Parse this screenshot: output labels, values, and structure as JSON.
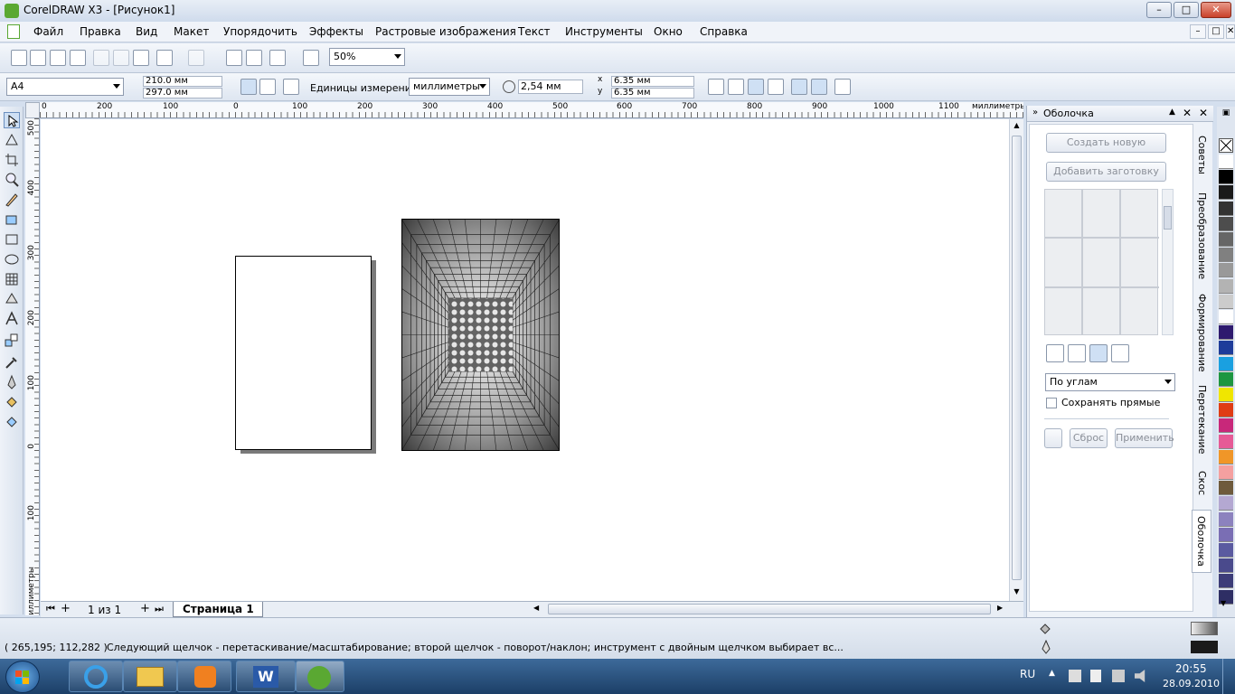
{
  "window": {
    "title": "CorelDRAW X3 - [Рисунок1]",
    "controls": {
      "minimize": "–",
      "maximize": "□",
      "close": "✕"
    }
  },
  "menu": {
    "items": [
      "Файл",
      "Правка",
      "Вид",
      "Макет",
      "Упорядочить",
      "Эффекты",
      "Растровые изображения",
      "Текст",
      "Инструменты",
      "Окно",
      "Справка"
    ]
  },
  "toolbar": {
    "zoom": "50%"
  },
  "property_bar": {
    "page_size": "A4",
    "width": "210.0 мм",
    "height": "297.0 мм",
    "units_label": "Единицы измерения:",
    "units_value": "миллиметры",
    "nudge": "2,54 мм",
    "dup_x": "6.35 мм",
    "dup_y": "6.35 мм",
    "x_label": "x",
    "y_label": "y"
  },
  "rulers": {
    "unit": "миллиметры",
    "h_ticks": [
      "0",
      "200",
      "100",
      "0",
      "100",
      "200",
      "300",
      "400",
      "500",
      "600",
      "700",
      "800",
      "900",
      "1000",
      "1100"
    ],
    "v_ticks": [
      "500",
      "400",
      "300",
      "200",
      "100",
      "0",
      "100"
    ],
    "v_unit": "миллиметры"
  },
  "page_nav": {
    "counter": "1 из 1",
    "tab": "Страница 1"
  },
  "docker": {
    "title": "Оболочка",
    "create_new": "Создать новую",
    "add_preset": "Добавить заготовку",
    "mapping_mode": "По углам",
    "keep_lines": "Сохранять прямые",
    "reset": "Сброс",
    "apply": "Применить"
  },
  "side_tabs": [
    "Советы",
    "Преобразование",
    "Формирование",
    "Перетекание",
    "Скос",
    "Оболочка"
  ],
  "palette": {
    "colors": [
      "#ffffff",
      "#000000",
      "#1a1a1a",
      "#333333",
      "#4d4d4d",
      "#666666",
      "#808080",
      "#999999",
      "#b3b3b3",
      "#cccccc",
      "#ffffff",
      "#2e1a6e",
      "#1e3c9a",
      "#1aa0e0",
      "#1e9640",
      "#f0e600",
      "#e03c14",
      "#c8287a",
      "#e65a96",
      "#f09628",
      "#f5a0a0",
      "#6e5a3c",
      "#b4a8d2",
      "#8c82be",
      "#7a6eb4",
      "#5a5aa0",
      "#4a4a8c",
      "#3c3c78",
      "#2e2e64"
    ]
  },
  "status": {
    "coords": "( 265,195; 112,282 )",
    "message": "Следующий щелчок - перетаскивание/масштабирование; второй щелчок - поворот/наклон; инструмент с двойным щелчком выбирает вс..."
  },
  "taskbar": {
    "lang": "RU",
    "time": "20:55",
    "date": "28.09.2010"
  }
}
